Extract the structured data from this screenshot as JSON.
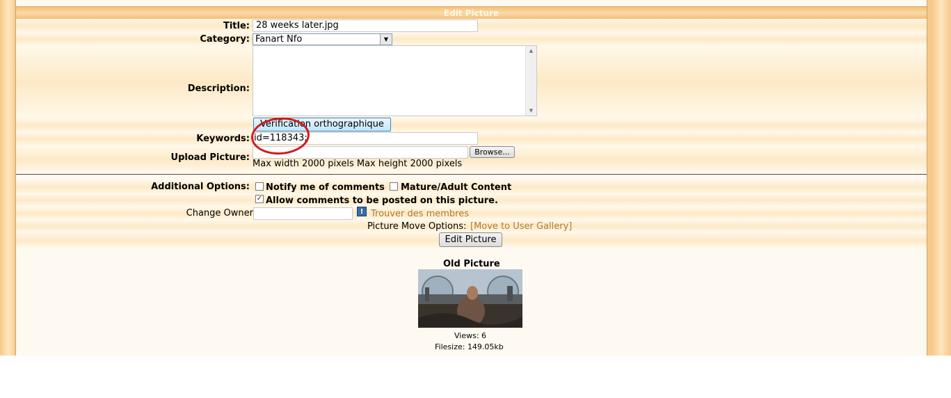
{
  "header": {
    "title": "Edit Picture"
  },
  "form": {
    "title_label": "Title:",
    "title_value": "28 weeks later.jpg",
    "category_label": "Category:",
    "category_value": "Fanart Nfo",
    "description_label": "Description:",
    "description_value": "",
    "spellcheck_button": "Verification orthographique",
    "keywords_label": "Keywords:",
    "keywords_value": "id=118343;",
    "upload_label": "Upload Picture:",
    "upload_value": "",
    "browse_button": "Browse...",
    "upload_hint": "Max width 2000 pixels Max height 2000 pixels"
  },
  "options": {
    "label": "Additional Options:",
    "notify": {
      "label": "Notify me of comments",
      "checked": false
    },
    "mature": {
      "label": "Mature/Adult Content",
      "checked": false
    },
    "allow_comments": {
      "label": "Allow comments to be posted on this picture.",
      "checked": true
    }
  },
  "owner": {
    "label": "Change Owner",
    "value": "",
    "find_link": "Trouver des membres"
  },
  "move": {
    "label": "Picture Move Options:",
    "link": "[Move to User Gallery]"
  },
  "submit_button": "Edit Picture",
  "old_picture": {
    "heading": "Old Picture",
    "views": "Views: 6",
    "filesize": "Filesize: 149.05kb"
  },
  "colors": {
    "accent": "#f3c37c",
    "link": "#b07a2a",
    "annotation": "#d2191c"
  }
}
